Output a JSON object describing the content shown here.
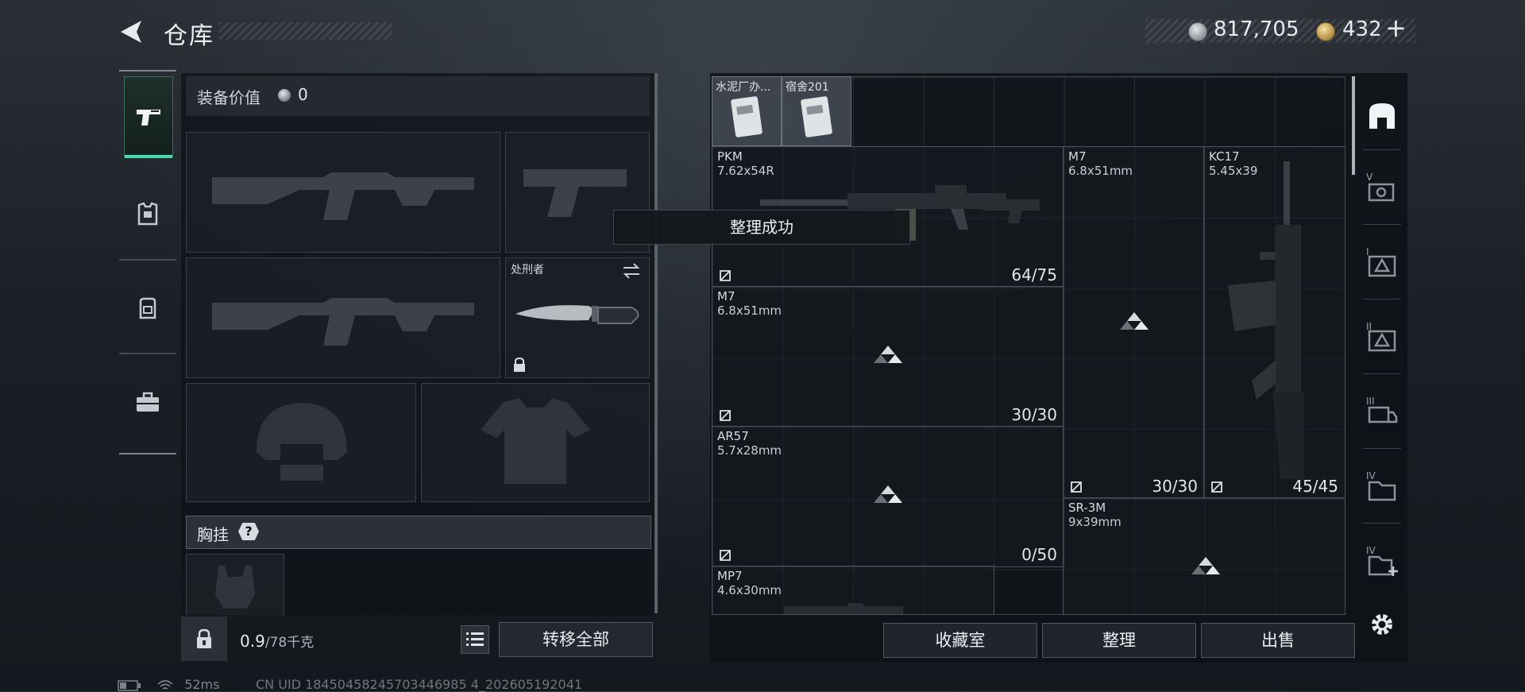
{
  "header": {
    "title": "仓库",
    "coins": "817,705",
    "premium": "432",
    "premium_add": "+"
  },
  "equipment": {
    "value_label": "装备价值",
    "value": "0",
    "melee_label": "处刑者",
    "chest_label": "胸挂",
    "chest_help": "?",
    "weight_current": "0.9",
    "weight_max": "/78千克",
    "transfer_all": "转移全部"
  },
  "storage": {
    "small_items": [
      {
        "name": "水泥厂办..."
      },
      {
        "name": "宿舍201"
      }
    ],
    "weapons": [
      {
        "name": "PKM",
        "caliber": "7.62x54R",
        "ammo": "64/75"
      },
      {
        "name": "M7",
        "caliber": "6.8x51mm",
        "ammo": "30/30"
      },
      {
        "name": "AR57",
        "caliber": "5.7x28mm",
        "ammo": "0/50"
      },
      {
        "name": "MP7",
        "caliber": "4.6x30mm"
      },
      {
        "name": "M7",
        "caliber": "6.8x51mm",
        "ammo": "30/30"
      },
      {
        "name": "KC17",
        "caliber": "5.45x39",
        "ammo": "45/45"
      },
      {
        "name": "SR-3M",
        "caliber": "9x39mm"
      }
    ],
    "toast": "整理成功"
  },
  "right_rail": [
    "V",
    "I",
    "II",
    "III",
    "IV",
    "IV"
  ],
  "buttons": {
    "collection": "收藏室",
    "organize": "整理",
    "sell": "出售"
  },
  "status": {
    "ping": "52ms",
    "uid": "CN UID 18450458245703446985 4_202605192041"
  }
}
